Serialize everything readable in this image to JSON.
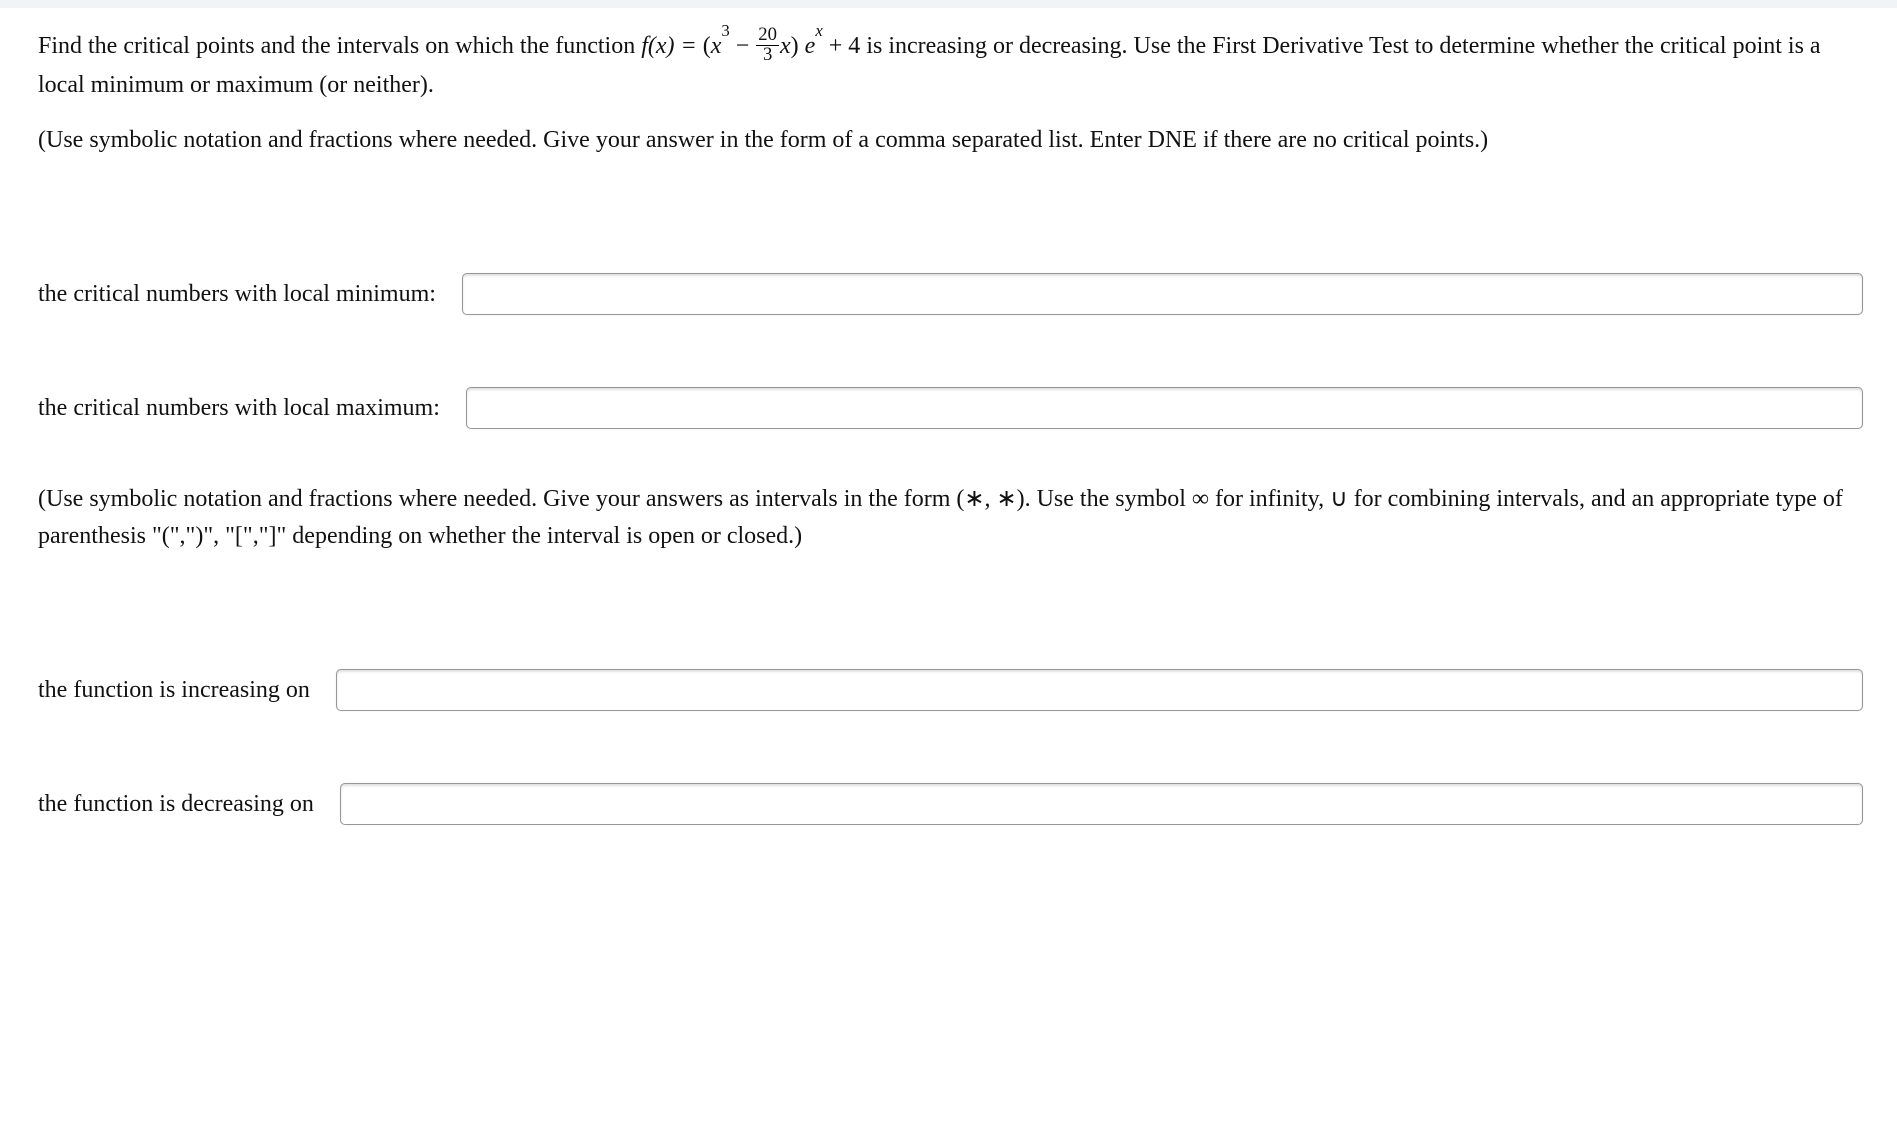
{
  "problem": {
    "text_before_fx": "Find the critical points and the intervals on which the function ",
    "fx_label": "f(x) = ",
    "expr_open": "(",
    "expr_x3": "x",
    "expr_sup3": "3",
    "expr_minus": " − ",
    "frac_num": "20",
    "frac_den": "3",
    "expr_x": "x",
    "expr_close": ") ",
    "expr_e": "e",
    "expr_supx": "x",
    "expr_plus4": " + 4",
    "text_after_expr": " is increasing or decreasing. Use the First Derivative Test to determine whether the critical point is a local minimum or maximum (or neither)."
  },
  "instruction1": "(Use symbolic notation and fractions where needed. Give your answer in the form of a comma separated list. Enter DNE if there are no critical points.)",
  "labels": {
    "local_min": "the critical numbers with local minimum:",
    "local_max": "the critical numbers with local maximum:",
    "increasing": "the function is increasing on",
    "decreasing": "the function is decreasing on"
  },
  "instruction2": "(Use symbolic notation and fractions where needed. Give your answers as intervals in the form (∗, ∗). Use the symbol ∞ for infinity, ∪ for combining intervals, and an appropriate type of parenthesis \"(\",\")\", \"[\",\"]\" depending on whether the interval is open or closed.)",
  "inputs": {
    "local_min_value": "",
    "local_max_value": "",
    "increasing_value": "",
    "decreasing_value": ""
  }
}
